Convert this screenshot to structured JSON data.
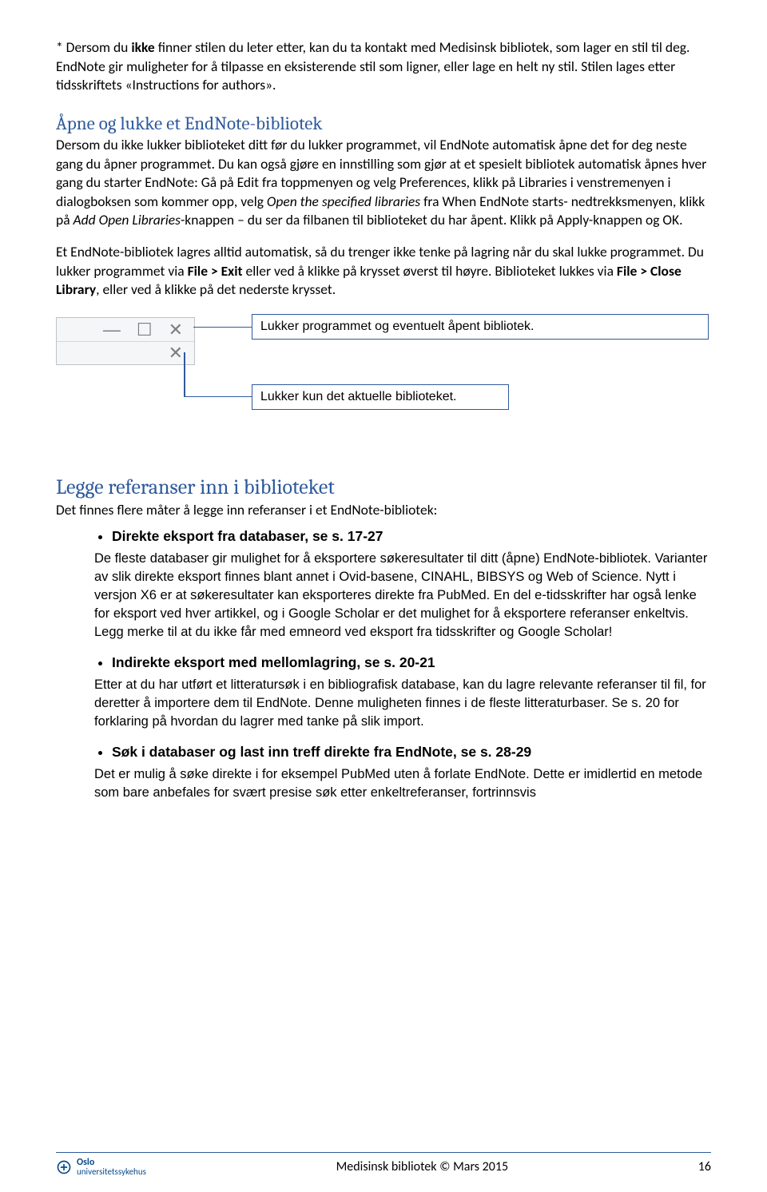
{
  "intro": {
    "p1_a": "* Dersom du ",
    "p1_b": "ikke",
    "p1_c": " finner stilen du leter etter, kan du ta kontakt med Medisinsk bibliotek, som lager en stil til deg. EndNote gir muligheter for å tilpasse en eksisterende stil som ligner, eller lage en helt ny stil. Stilen lages etter tidsskriftets «Instructions for authors»."
  },
  "sec1": {
    "title": "Åpne og lukke et EndNote-bibliotek",
    "p1_a": "Dersom du ikke lukker biblioteket ditt før du lukker programmet, vil EndNote automatisk åpne det for deg neste gang du åpner programmet. Du kan også gjøre en innstilling som gjør at et spesielt bibliotek automatisk åpnes hver gang du starter EndNote: Gå på Edit fra toppmenyen og velg Preferences, klikk på Libraries i venstremenyen i dialogboksen som kommer opp, velg ",
    "p1_b": "Open the specified libraries",
    "p1_c": " fra When EndNote starts- nedtrekksmenyen, klikk på ",
    "p1_d": "Add Open Libraries",
    "p1_e": "-knappen – du ser da filbanen til biblioteket du har åpent. Klikk på Apply-knappen og OK.",
    "p2_a": "Et EndNote-bibliotek lagres alltid automatisk, så du trenger ikke tenke på lagring når du skal lukke programmet. Du lukker programmet via ",
    "p2_b": "File > Exit",
    "p2_c": " eller ved å klikke på krysset øverst til høyre. Biblioteket lukkes via ",
    "p2_d": "File > Close Library",
    "p2_e": ", eller ved å klikke på det nederste krysset."
  },
  "callouts": {
    "c1": "Lukker programmet og eventuelt åpent bibliotek.",
    "c2": "Lukker kun det aktuelle biblioteket."
  },
  "sec2": {
    "title": "Legge referanser inn i biblioteket",
    "lead": "Det finnes flere måter å legge inn referanser i et EndNote-bibliotek:",
    "items": {
      "a": {
        "title": "Direkte eksport fra databaser, se s. 17-27",
        "body": "De fleste databaser gir mulighet for å eksportere søkeresultater til ditt (åpne) EndNote-bibliotek. Varianter av slik direkte eksport finnes blant annet i Ovid-basene, CINAHL, BIBSYS og Web of Science. Nytt i versjon X6 er at søkeresultater kan eksporteres direkte fra PubMed. En del e-tidsskrifter har også lenke for eksport ved hver artikkel, og i Google Scholar er det mulighet for å eksportere referanser enkeltvis. Legg merke til at du ikke får med emneord ved eksport fra tidsskrifter og Google Scholar!"
      },
      "b": {
        "title": "Indirekte eksport med mellomlagring, se s. 20-21",
        "body": "Etter at du har utført et litteratursøk i en bibliografisk database, kan du lagre relevante referanser til fil, for deretter å importere dem til EndNote. Denne muligheten finnes i de fleste litteraturbaser. Se s. 20 for forklaring på hvordan du lagrer med tanke på slik import."
      },
      "c": {
        "title": "Søk i databaser og last inn treff direkte fra EndNote, se s. 28-29",
        "body": "Det er mulig å søke direkte i for eksempel PubMed uten å forlate EndNote. Dette er imidlertid en metode som bare anbefales for svært presise søk etter enkeltreferanser, fortrinnsvis"
      }
    }
  },
  "footer": {
    "org1": "Oslo",
    "org2": "universitetssykehus",
    "center": "Medisinsk bibliotek © Mars 2015",
    "page": "16"
  },
  "icons": {
    "min": "—",
    "max": "☐",
    "close": "✕",
    "close2": "✕"
  }
}
